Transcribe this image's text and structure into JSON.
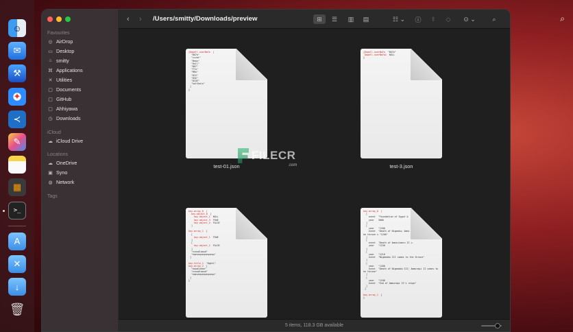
{
  "toolbar": {
    "back_icon": "‹",
    "forward_icon": "›",
    "path": "/Users/smitty/Downloads/preview"
  },
  "sidebar": {
    "favourites_title": "Favourites",
    "favourites": [
      {
        "label": "AirDrop",
        "icon": "airdrop-icon"
      },
      {
        "label": "Desktop",
        "icon": "desktop-icon"
      },
      {
        "label": "smitty",
        "icon": "home-icon"
      },
      {
        "label": "Applications",
        "icon": "applications-icon"
      },
      {
        "label": "Utilities",
        "icon": "utilities-icon"
      },
      {
        "label": "Documents",
        "icon": "folder-icon"
      },
      {
        "label": "GitHub",
        "icon": "folder-icon"
      },
      {
        "label": "Ahhiyawa",
        "icon": "folder-icon"
      },
      {
        "label": "Downloads",
        "icon": "downloads-icon"
      }
    ],
    "icloud_title": "iCloud",
    "icloud": [
      {
        "label": "iCloud Drive",
        "icon": "cloud-icon"
      }
    ],
    "locations_title": "Locations",
    "locations": [
      {
        "label": "OneDrive",
        "icon": "cloud-icon"
      },
      {
        "label": "Syno",
        "icon": "network-drive-icon"
      },
      {
        "label": "Network",
        "icon": "globe-icon"
      }
    ],
    "tags_title": "Tags"
  },
  "files": [
    {
      "name": "test-01.json"
    },
    {
      "name": "test-3.json"
    },
    {
      "name": ""
    },
    {
      "name": ""
    }
  ],
  "status": {
    "text": "5 items, 118.3 GB available"
  },
  "watermark": {
    "text": "FILECR",
    "suffix": ".com"
  },
  "colors": {
    "close": "#ff5f57",
    "minimize": "#febc2e",
    "zoom": "#28c840",
    "json_key": "#d2231f"
  }
}
